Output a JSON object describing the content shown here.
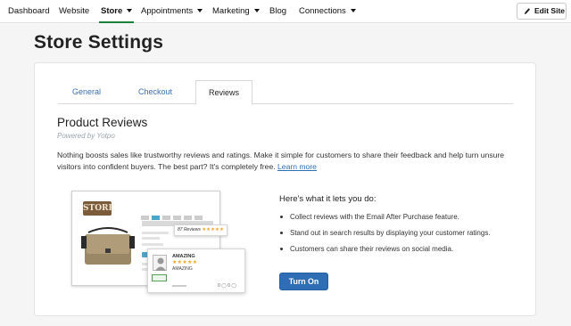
{
  "nav": {
    "items": [
      {
        "label": "Dashboard",
        "dropdown": false,
        "active": false
      },
      {
        "label": "Website",
        "dropdown": false,
        "active": false
      },
      {
        "label": "Store",
        "dropdown": true,
        "active": true
      },
      {
        "label": "Appointments",
        "dropdown": true,
        "active": false
      },
      {
        "label": "Marketing",
        "dropdown": true,
        "active": false
      },
      {
        "label": "Blog",
        "dropdown": false,
        "active": false
      },
      {
        "label": "Connections",
        "dropdown": true,
        "active": false
      }
    ],
    "edit_site_label": "Edit Site",
    "edit_site_icon": "pencil-icon",
    "active_color": "#1a7f37"
  },
  "page": {
    "title": "Store Settings"
  },
  "tabs": [
    {
      "label": "General",
      "active": false
    },
    {
      "label": "Checkout",
      "active": false
    },
    {
      "label": "Reviews",
      "active": true
    }
  ],
  "reviews": {
    "title": "Product Reviews",
    "powered_by": "Powered by Yotpo",
    "description": "Nothing boosts sales like trustworthy reviews and ratings. Make it simple for customers to share their feedback and help turn unsure visitors into confident buyers. The best part? It's completely free.",
    "learn_more": "Learn more",
    "illustration": {
      "store_logo": "STORE",
      "badge_text": "87 Reviews",
      "badge_stars": "★★★★★",
      "review_title": "AMAZING",
      "review_stars": "★★★★★",
      "review_body": "AMAZING",
      "review_votes": "0 ◯  0 ◯"
    },
    "lets_you_do": "Here's what it lets you do:",
    "features": [
      "Collect reviews with the Email After Purchase feature.",
      "Stand out in search results by displaying your customer ratings.",
      "Customers can share their reviews on social media."
    ],
    "turn_on_label": "Turn On",
    "button_color": "#2f6db5",
    "link_color": "#2a6fb8"
  }
}
